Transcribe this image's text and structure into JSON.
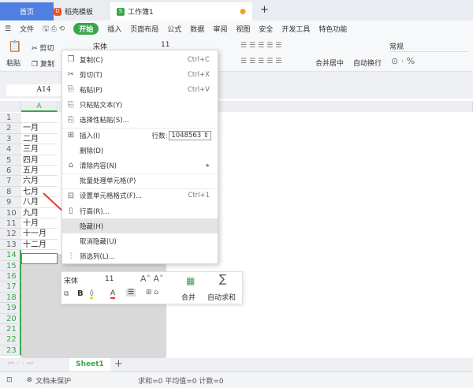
{
  "tabs": [
    {
      "label": "首页",
      "active": false
    },
    {
      "label": "稻壳模板",
      "active": false
    },
    {
      "label": "工作簿1",
      "active": true
    }
  ],
  "new_tab": "+",
  "menu": {
    "file": "文件",
    "start": "开始",
    "items": [
      "插入",
      "页面布局",
      "公式",
      "数据",
      "审阅",
      "视图",
      "安全",
      "开发工具",
      "特色功能"
    ]
  },
  "ribbon": {
    "paste": "粘贴",
    "cut": "剪切",
    "copy": "复制",
    "font": "宋体",
    "size": "11",
    "merge": "合并居中",
    "wrap": "自动换行",
    "number_format": "常规"
  },
  "name_box": "A14",
  "columns": [
    "A"
  ],
  "rows": [
    "1",
    "2",
    "3",
    "4",
    "5",
    "6",
    "7",
    "8",
    "9",
    "10",
    "11",
    "12",
    "13",
    "14",
    "15",
    "16",
    "17",
    "18",
    "19",
    "20",
    "21",
    "22",
    "23"
  ],
  "cells_a": [
    "",
    "一月",
    "二月",
    "三月",
    "四月",
    "五月",
    "六月",
    "七月",
    "八月",
    "九月",
    "十月",
    "十一月",
    "十二月"
  ],
  "context_menu": [
    {
      "icon": "copy-icon",
      "label": "复制(C)",
      "shortcut": "Ctrl+C"
    },
    {
      "icon": "cut-icon",
      "label": "剪切(T)",
      "shortcut": "Ctrl+X"
    },
    {
      "icon": "paste-icon",
      "label": "粘贴(P)",
      "shortcut": "Ctrl+V"
    },
    {
      "icon": "paste-text-icon",
      "label": "只粘贴文本(Y)",
      "shortcut": ""
    },
    {
      "icon": "paste-special-icon",
      "label": "选择性粘贴(S)...",
      "shortcut": ""
    },
    {
      "icon": "insert-icon",
      "label": "插入(I)",
      "shortcut": ""
    },
    {
      "icon": "",
      "label": "删除(D)",
      "shortcut": ""
    },
    {
      "icon": "eraser-icon",
      "label": "清除内容(N)",
      "shortcut": "▸"
    },
    {
      "icon": "",
      "label": "批量处理单元格(P)",
      "shortcut": ""
    },
    {
      "icon": "format-cells-icon",
      "label": "设置单元格格式(F)...",
      "shortcut": "Ctrl+1"
    },
    {
      "icon": "row-height-icon",
      "label": "行高(R)...",
      "shortcut": ""
    },
    {
      "icon": "",
      "label": "隐藏(H)",
      "shortcut": "",
      "highlighted": true
    },
    {
      "icon": "",
      "label": "取消隐藏(U)",
      "shortcut": ""
    },
    {
      "icon": "filter-icon",
      "label": "筛选列(L)...",
      "shortcut": ""
    }
  ],
  "insert_rows": {
    "label": "行数:",
    "value": "1048563"
  },
  "mini_toolbar": {
    "font": "宋体",
    "size": "11",
    "bold": "B",
    "merge": "合并",
    "autosum": "自动求和"
  },
  "sheet_tab": "Sheet1",
  "status": {
    "protect": "文档未保护",
    "summary": "求和=0 平均值=0 计数=0"
  },
  "colors": {
    "accent": "#3aa64a",
    "arrow": "#e53935"
  }
}
